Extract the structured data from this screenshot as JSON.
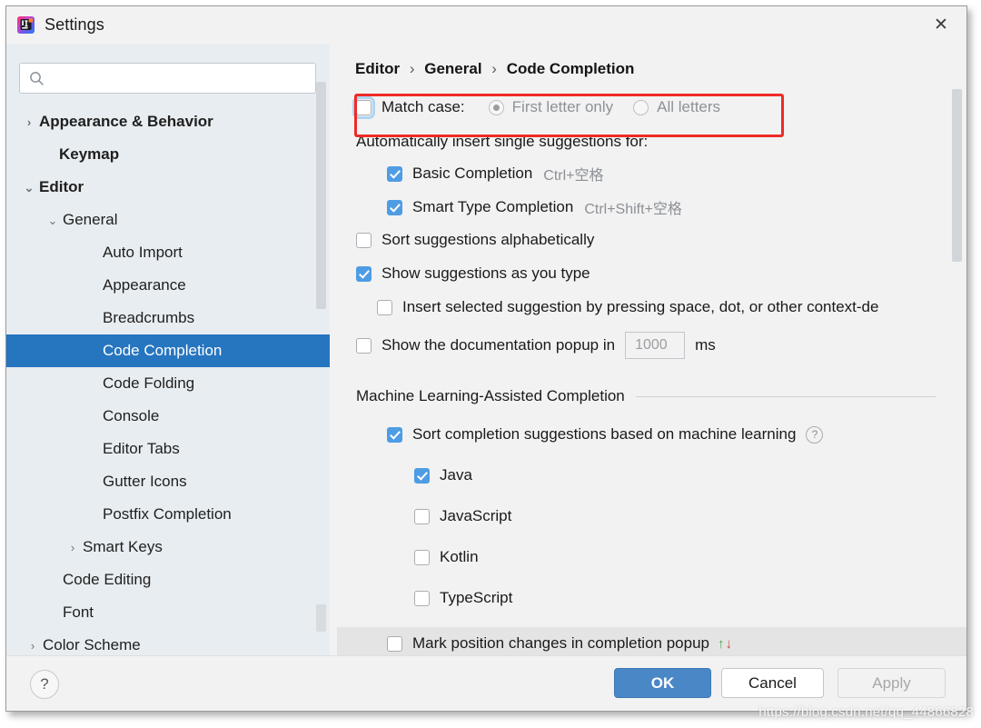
{
  "window": {
    "title": "Settings",
    "logo_icon": "intellij-idea-logo",
    "close_icon": "close-icon"
  },
  "search": {
    "value": "",
    "placeholder": "",
    "icon": "search-icon"
  },
  "sidebar": {
    "items": [
      {
        "label": "Appearance & Behavior",
        "indent": 14,
        "twisty": "›",
        "bold": true,
        "selected": false
      },
      {
        "label": "Keymap",
        "indent": 36,
        "twisty": "",
        "bold": true,
        "selected": false
      },
      {
        "label": "Editor",
        "indent": 14,
        "twisty": "⌄",
        "bold": true,
        "selected": false
      },
      {
        "label": "General",
        "indent": 40,
        "twisty": "⌄",
        "bold": false,
        "selected": false
      },
      {
        "label": "Auto Import",
        "indent": 84,
        "twisty": "",
        "bold": false,
        "selected": false
      },
      {
        "label": "Appearance",
        "indent": 84,
        "twisty": "",
        "bold": false,
        "selected": false
      },
      {
        "label": "Breadcrumbs",
        "indent": 84,
        "twisty": "",
        "bold": false,
        "selected": false
      },
      {
        "label": "Code Completion",
        "indent": 84,
        "twisty": "",
        "bold": false,
        "selected": true
      },
      {
        "label": "Code Folding",
        "indent": 84,
        "twisty": "",
        "bold": false,
        "selected": false
      },
      {
        "label": "Console",
        "indent": 84,
        "twisty": "",
        "bold": false,
        "selected": false
      },
      {
        "label": "Editor Tabs",
        "indent": 84,
        "twisty": "",
        "bold": false,
        "selected": false
      },
      {
        "label": "Gutter Icons",
        "indent": 84,
        "twisty": "",
        "bold": false,
        "selected": false
      },
      {
        "label": "Postfix Completion",
        "indent": 84,
        "twisty": "",
        "bold": false,
        "selected": false
      },
      {
        "label": "Smart Keys",
        "indent": 62,
        "twisty": "›",
        "bold": false,
        "selected": false
      },
      {
        "label": "Code Editing",
        "indent": 40,
        "twisty": "",
        "bold": false,
        "selected": false
      },
      {
        "label": "Font",
        "indent": 40,
        "twisty": "",
        "bold": false,
        "selected": false
      },
      {
        "label": "Color Scheme",
        "indent": 18,
        "twisty": "›",
        "bold": false,
        "selected": false
      }
    ]
  },
  "content": {
    "breadcrumb": [
      "Editor",
      "General",
      "Code Completion"
    ],
    "breadcrumb_separator": "›",
    "match_case": {
      "label": "Match case:",
      "checked": false,
      "options": [
        {
          "label": "First letter only",
          "selected": true,
          "enabled": false
        },
        {
          "label": "All letters",
          "selected": false,
          "enabled": false
        }
      ]
    },
    "auto_insert_header": "Automatically insert single suggestions for:",
    "auto_insert_items": [
      {
        "label": "Basic Completion",
        "shortcut": "Ctrl+空格",
        "checked": true
      },
      {
        "label": "Smart Type Completion",
        "shortcut": "Ctrl+Shift+空格",
        "checked": true
      }
    ],
    "sort_alphabetically": {
      "label": "Sort suggestions alphabetically",
      "checked": false
    },
    "show_as_you_type": {
      "label": "Show suggestions as you type",
      "checked": true
    },
    "insert_selected": {
      "label": "Insert selected suggestion by pressing space, dot, or other context-de",
      "checked": false
    },
    "doc_popup": {
      "label": "Show the documentation popup in",
      "checked": false,
      "value": "1000",
      "unit": "ms"
    },
    "ml_section_title": "Machine Learning-Assisted Completion",
    "ml_sort": {
      "label": "Sort completion suggestions based on machine learning",
      "checked": true,
      "help_icon": "help-circle-icon"
    },
    "ml_languages": [
      {
        "label": "Java",
        "checked": true
      },
      {
        "label": "JavaScript",
        "checked": false
      },
      {
        "label": "Kotlin",
        "checked": false
      },
      {
        "label": "TypeScript",
        "checked": false
      }
    ],
    "mark_position": {
      "label": "Mark position changes in completion popup",
      "checked": false,
      "up_arrow": "↑",
      "down_arrow": "↓"
    }
  },
  "footer": {
    "help_label": "?",
    "ok_label": "OK",
    "cancel_label": "Cancel",
    "apply_label": "Apply"
  },
  "watermark": "https://blog.csdn.net/qq_44866828",
  "colors": {
    "selection_blue": "#2675bf",
    "checkbox_blue": "#4e9ce4",
    "ok_button_blue": "#4a87c7",
    "annotation_red": "#ee2b26",
    "sidebar_bg": "#e8edf1",
    "panel_bg": "#f2f2f2",
    "arrow_up_green": "#4fa64f",
    "arrow_down_red": "#d3443c"
  }
}
